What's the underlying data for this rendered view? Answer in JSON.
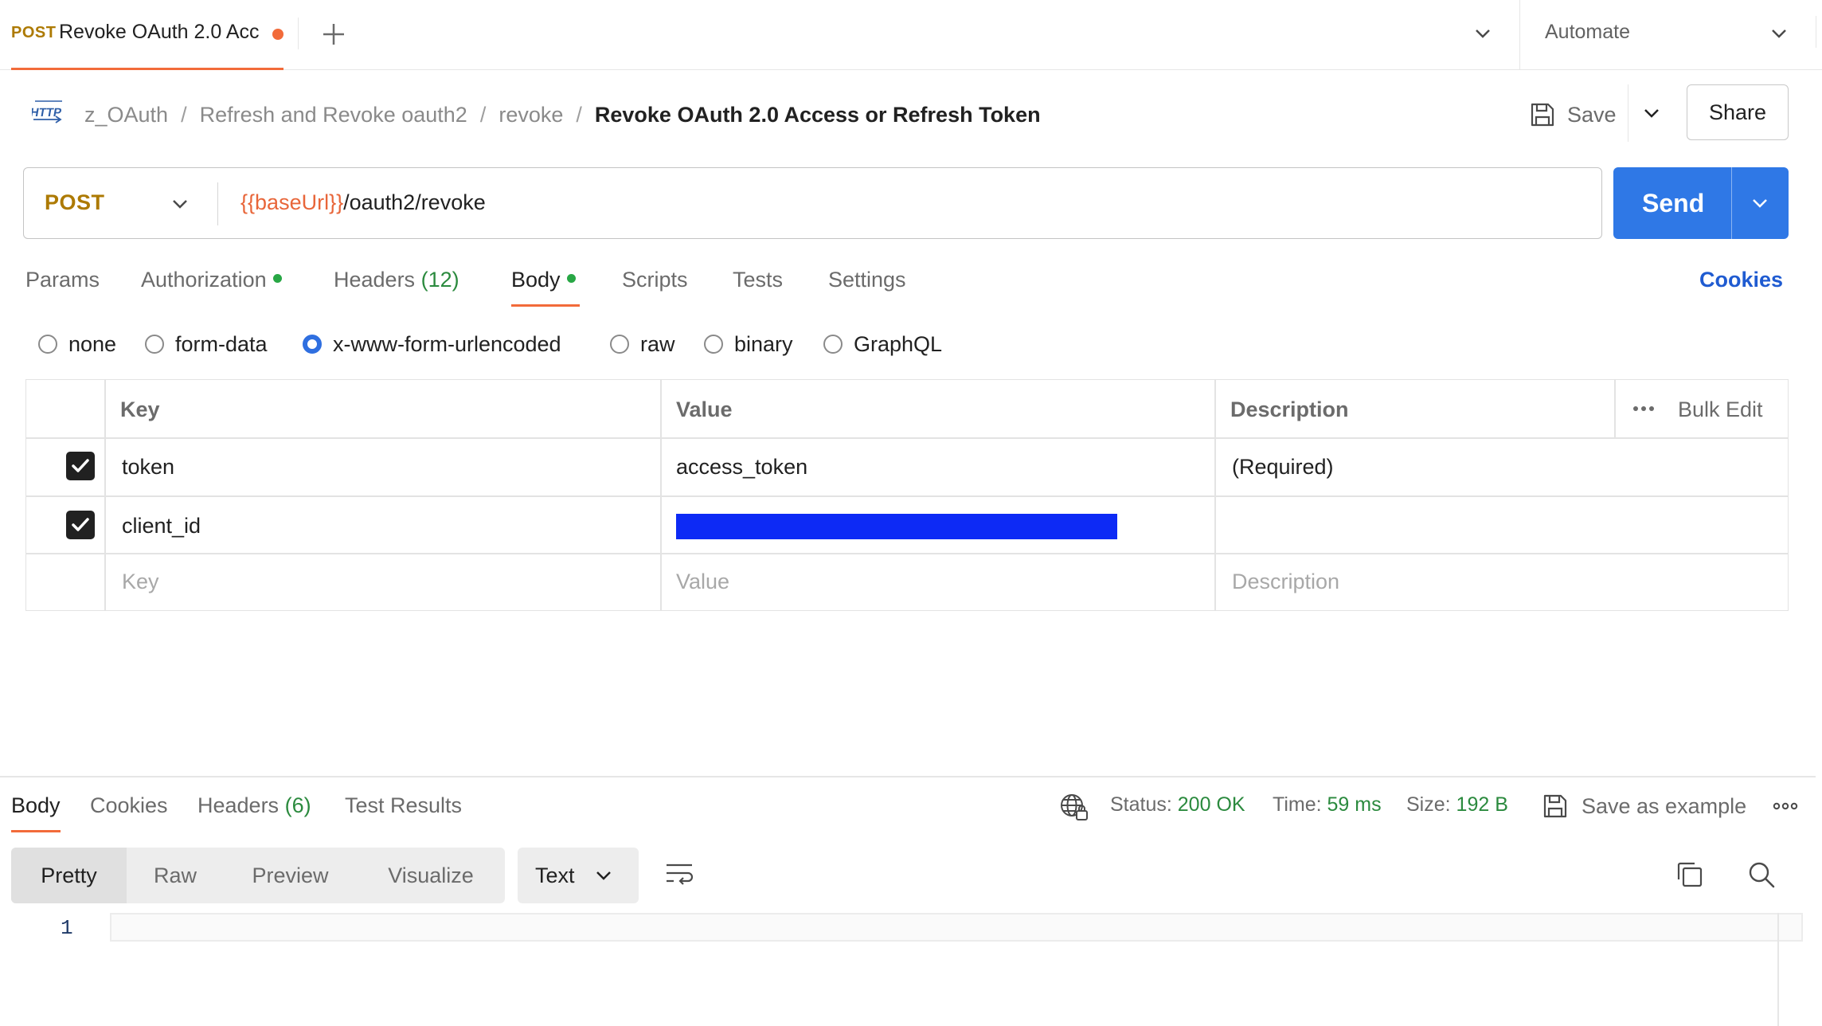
{
  "tab": {
    "method": "POST",
    "name": "Revoke OAuth 2.0 Acc"
  },
  "workspace_menu": {
    "label": "Automate"
  },
  "breadcrumb": {
    "items": [
      "z_OAuth",
      "Refresh and Revoke oauth2",
      "revoke"
    ],
    "separator": "/",
    "current": "Revoke OAuth 2.0 Access or Refresh Token"
  },
  "toolbar": {
    "save_label": "Save",
    "share_label": "Share"
  },
  "request": {
    "method": "POST",
    "url_variable": "{{baseUrl}}",
    "url_path": "/oauth2/revoke",
    "send_label": "Send"
  },
  "request_tabs": {
    "params": "Params",
    "authorization": "Authorization",
    "headers": "Headers",
    "headers_count": "(12)",
    "body": "Body",
    "scripts": "Scripts",
    "tests": "Tests",
    "settings": "Settings",
    "cookies": "Cookies"
  },
  "body_types": {
    "options": [
      "none",
      "form-data",
      "x-www-form-urlencoded",
      "raw",
      "binary",
      "GraphQL"
    ],
    "selected": "x-www-form-urlencoded"
  },
  "table": {
    "headers": {
      "key": "Key",
      "value": "Value",
      "description": "Description",
      "bulk_edit": "Bulk Edit"
    },
    "rows": [
      {
        "checked": true,
        "key": "token",
        "value": "access_token",
        "description": "(Required)"
      },
      {
        "checked": true,
        "key": "client_id",
        "value": "",
        "value_redacted": true,
        "description": ""
      }
    ],
    "placeholders": {
      "key": "Key",
      "value": "Value",
      "description": "Description"
    }
  },
  "response": {
    "tabs": {
      "body": "Body",
      "cookies": "Cookies",
      "headers": "Headers",
      "headers_count": "(6)",
      "test_results": "Test Results"
    },
    "status_label": "Status:",
    "status_value": "200 OK",
    "time_label": "Time:",
    "time_value": "59 ms",
    "size_label": "Size:",
    "size_value": "192 B",
    "save_example": "Save as example",
    "view_modes": [
      "Pretty",
      "Raw",
      "Preview",
      "Visualize"
    ],
    "active_view": "Pretty",
    "format": "Text",
    "line_number": "1"
  },
  "colors": {
    "accent_orange": "#f26b3a",
    "method_post": "#ad7a03",
    "send_blue": "#2f78e6",
    "status_green": "#2b8a3e",
    "redaction_blue": "#0d2af5"
  }
}
